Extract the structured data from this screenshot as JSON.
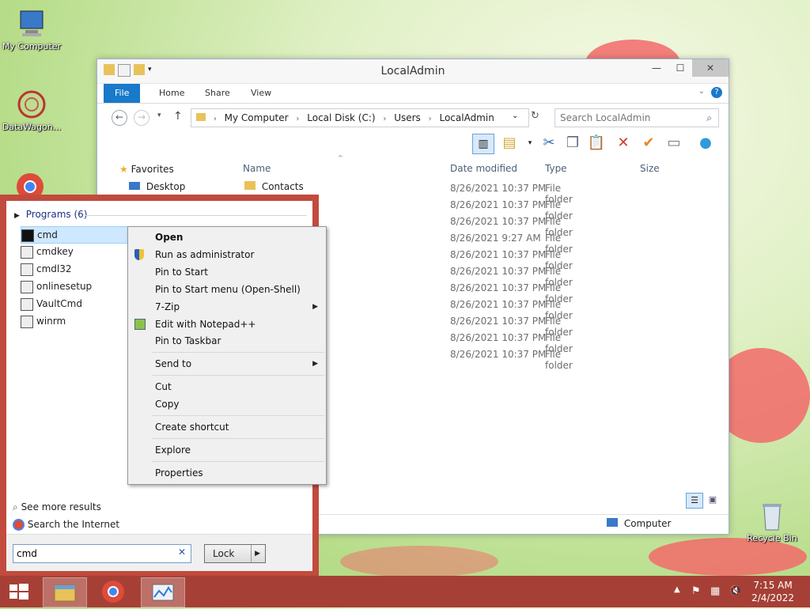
{
  "desktop": {
    "icons": [
      {
        "label": "My Computer"
      },
      {
        "label": "DataWagon..."
      },
      {
        "label": "Recycle Bin"
      }
    ]
  },
  "explorer": {
    "title": "LocalAdmin",
    "tabs": [
      "File",
      "Home",
      "Share",
      "View"
    ],
    "address": [
      "My Computer",
      "Local Disk (C:)",
      "Users",
      "LocalAdmin"
    ],
    "search_placeholder": "Search LocalAdmin",
    "columns": {
      "name": "Name",
      "date": "Date modified",
      "type": "Type",
      "size": "Size"
    },
    "nav": {
      "favorites": "Favorites",
      "desktop": "Desktop"
    },
    "first_item": "Contacts",
    "rows": [
      {
        "date": "8/26/2021 10:37 PM",
        "type": "File folder"
      },
      {
        "date": "8/26/2021 10:37 PM",
        "type": "File folder"
      },
      {
        "date": "8/26/2021 10:37 PM",
        "type": "File folder"
      },
      {
        "date": "8/26/2021 9:27 AM",
        "type": "File folder"
      },
      {
        "date": "8/26/2021 10:37 PM",
        "type": "File folder"
      },
      {
        "date": "8/26/2021 10:37 PM",
        "type": "File folder"
      },
      {
        "date": "8/26/2021 10:37 PM",
        "type": "File folder"
      },
      {
        "date": "8/26/2021 10:37 PM",
        "type": "File folder"
      },
      {
        "date": "8/26/2021 10:37 PM",
        "type": "File folder"
      },
      {
        "date": "8/26/2021 10:37 PM",
        "type": "File folder"
      },
      {
        "date": "8/26/2021 10:37 PM",
        "type": "File folder"
      }
    ],
    "status_location": "Computer"
  },
  "start": {
    "programs_header": "Programs (6)",
    "programs": [
      "cmd",
      "cmdkey",
      "cmdl32",
      "onlinesetup",
      "VaultCmd",
      "winrm"
    ],
    "see_more": "See more results",
    "search_internet": "Search the Internet",
    "search_value": "cmd",
    "lock_label": "Lock"
  },
  "context_menu": {
    "open": "Open",
    "run_admin": "Run as administrator",
    "pin_start": "Pin to Start",
    "pin_start_menu": "Pin to Start menu (Open-Shell)",
    "zip": "7-Zip",
    "notepad": "Edit with Notepad++",
    "pin_taskbar": "Pin to Taskbar",
    "send_to": "Send to",
    "cut": "Cut",
    "copy": "Copy",
    "create_shortcut": "Create shortcut",
    "explore": "Explore",
    "properties": "Properties"
  },
  "taskbar": {
    "time": "7:15 AM",
    "date": "2/4/2022"
  }
}
